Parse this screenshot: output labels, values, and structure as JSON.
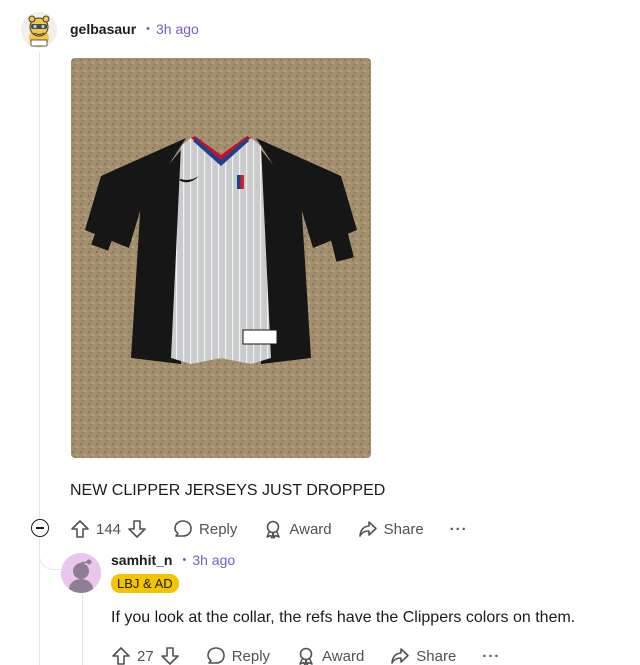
{
  "comment": {
    "author": "gelbasaur",
    "separator": "•",
    "time": "3h ago",
    "text": "NEW CLIPPER JERSEYS JUST DROPPED",
    "votes": "144",
    "reply_label": "Reply",
    "award_label": "Award",
    "share_label": "Share",
    "more_label": "···"
  },
  "reply": {
    "author": "samhit_n",
    "separator": "•",
    "time": "3h ago",
    "flair": "LBJ & AD",
    "text": "If you look at the collar, the refs have the Clippers colors on them.",
    "votes": "27",
    "reply_label": "Reply",
    "award_label": "Award",
    "share_label": "Share",
    "more_label": "···"
  },
  "colors": {
    "meta_purple": "#7a5cc0",
    "flair_yellow": "#f4c400",
    "carpet": "#a4906f",
    "jersey_gray": "#c9cbcd",
    "jersey_black": "#161616",
    "collar_red": "#c8102e",
    "collar_blue": "#1d428a"
  },
  "icons": {
    "upvote": "arrow-up-icon",
    "downvote": "arrow-down-icon",
    "reply": "speech-bubble-icon",
    "award": "award-ribbon-icon",
    "share": "share-arrow-icon",
    "collapse": "minus-circle-icon"
  }
}
